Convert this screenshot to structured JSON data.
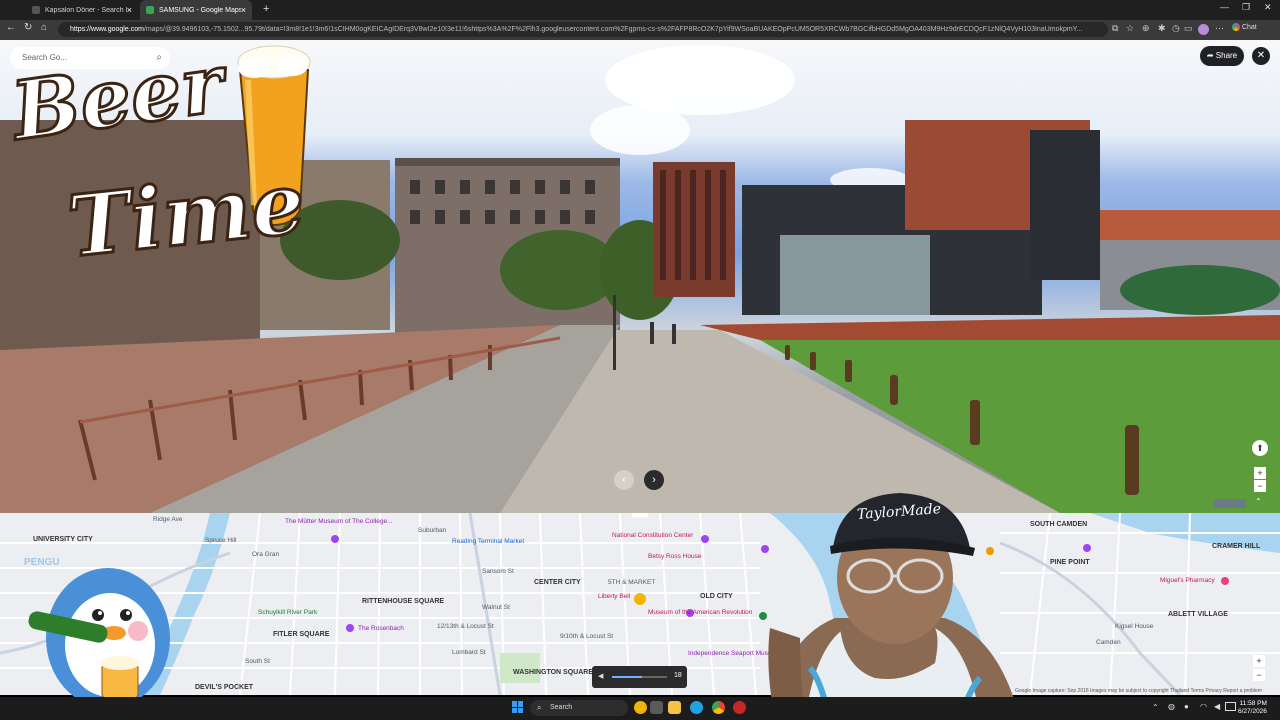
{
  "browser": {
    "tabs": [
      {
        "title": "Kapsalon Döner - Search Images",
        "active": false
      },
      {
        "title": "SAMSUNG - Google Maps",
        "active": true
      }
    ],
    "url_host": "https://www.google.com",
    "url_path": "/maps/@39.9496103,-75.1502...",
    "url_rest": "95.79t/data=!3m8!1e1!3m6!1sCIHM0ogKEICAgIDErq3V8wI2e10!3e11!6shttps%3A%2F%2Flh3.googleusercontent.com%2Fgpms-cs-s%2FAFP8RcO2K7pYif9WSoaBUAKEOpPcUM5OR5XRCWb7BGCifbHGDd5MgOA403M9Hz9drECDQcF1zNlQ4VyH103InaUmokpmY...",
    "chat_label": "Chat"
  },
  "streetview": {
    "search_placeholder": "Search Go...",
    "share_label": "Share",
    "close_symbol": "✕",
    "prev_symbol": "‹",
    "next_symbol": "›"
  },
  "overlay": {
    "beer_word": "Beer",
    "time_word": "Time"
  },
  "map": {
    "labels": [
      {
        "text": "UNIVERSITY CITY",
        "cls": "bold"
      },
      {
        "text": "The Mütter Museum of The College...",
        "cls": "purple"
      },
      {
        "text": "Reading Terminal Market",
        "cls": "blue"
      },
      {
        "text": "National Constitution Center",
        "cls": "pink"
      },
      {
        "text": "Betsy Ross House",
        "cls": "pink"
      },
      {
        "text": "CENTER CITY",
        "cls": "bold"
      },
      {
        "text": "5TH & MARKET",
        "cls": ""
      },
      {
        "text": "RITTENHOUSE SQUARE",
        "cls": "bold"
      },
      {
        "text": "Liberty Bell",
        "cls": "pink"
      },
      {
        "text": "OLD CITY",
        "cls": "bold"
      },
      {
        "text": "Museum of the American Revolution",
        "cls": "pink"
      },
      {
        "text": "Schuylkill River Park",
        "cls": "green"
      },
      {
        "text": "FITLER SQUARE",
        "cls": "bold"
      },
      {
        "text": "The Rosenbach",
        "cls": "purple"
      },
      {
        "text": "12/13th & Locust St",
        "cls": ""
      },
      {
        "text": "9/10th & Locust St",
        "cls": ""
      },
      {
        "text": "Independence Seaport Museum",
        "cls": "purple"
      },
      {
        "text": "WASHINGTON SQUARE WEST",
        "cls": "bold"
      },
      {
        "text": "DEVIL'S POCKET",
        "cls": "bold"
      },
      {
        "text": "PINE POINT",
        "cls": "bold"
      },
      {
        "text": "CRAMER HILL",
        "cls": "bold"
      },
      {
        "text": "Miguel's Pharmacy",
        "cls": "pink"
      },
      {
        "text": "ABLETT VILLAGE",
        "cls": "bold"
      },
      {
        "text": "Kigsel House",
        "cls": ""
      },
      {
        "text": "SOUTH CAMDEN",
        "cls": "bold"
      },
      {
        "text": "Spruce Hill",
        "cls": ""
      },
      {
        "text": "Ora Gran",
        "cls": ""
      },
      {
        "text": "Sansom St",
        "cls": ""
      },
      {
        "text": "Walnut St",
        "cls": ""
      },
      {
        "text": "South St",
        "cls": ""
      },
      {
        "text": "Lombard St",
        "cls": ""
      },
      {
        "text": "Suburban",
        "cls": ""
      },
      {
        "text": "Ridge Ave",
        "cls": ""
      },
      {
        "text": "Camden",
        "cls": ""
      }
    ],
    "zoom_value": "18",
    "footer": "Google  Image capture: Sep 2018   Images may be subject to copyright   Thailand   Terms   Privacy   Report a problem"
  },
  "penguin_sticker": {
    "caption": "PENGU"
  },
  "webcam": {
    "cap_text": "TaylorMade"
  },
  "taskbar": {
    "search_label": "Search",
    "time": "11:58 PM",
    "date": "6/27/2026"
  },
  "colors": {
    "chrome_bg": "#1f1f1f",
    "toolbar_bg": "#3a3a3a",
    "map_bg": "#eceef1",
    "grass": "#5d9c3a",
    "brick": "#8c3b2c"
  }
}
